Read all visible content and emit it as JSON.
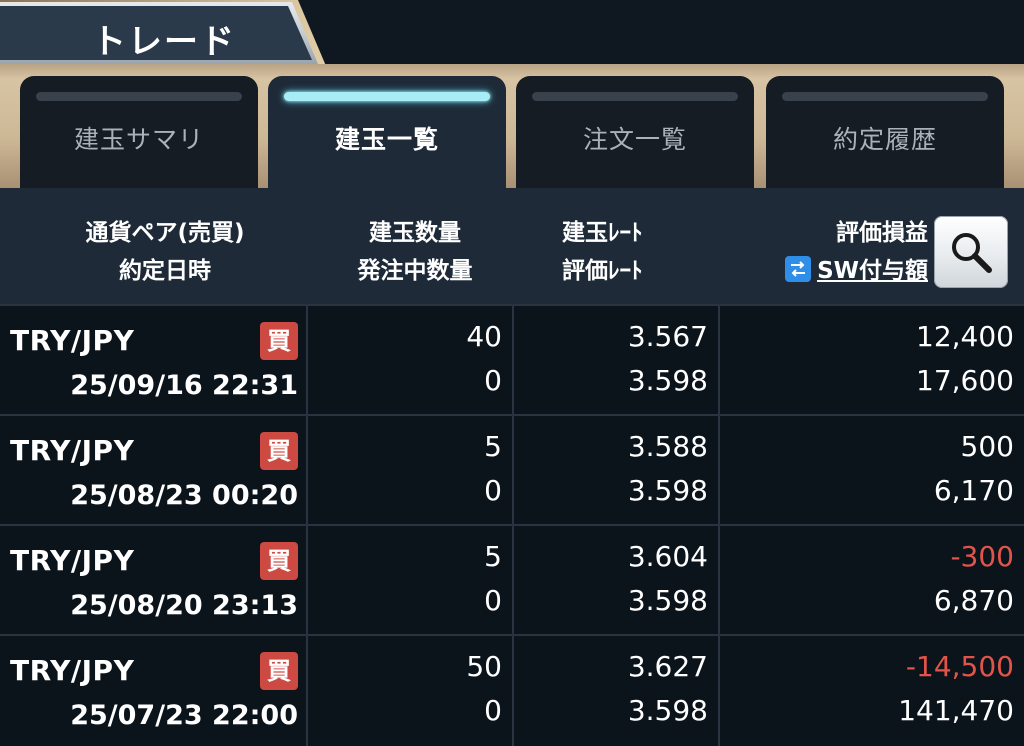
{
  "header": {
    "title": "トレード"
  },
  "tabs": [
    {
      "label": "建玉サマリ",
      "active": false
    },
    {
      "label": "建玉一覧",
      "active": true
    },
    {
      "label": "注文一覧",
      "active": false
    },
    {
      "label": "約定履歴",
      "active": false
    }
  ],
  "columns": {
    "col1_line1": "通貨ペア(売買)",
    "col1_line2": "約定日時",
    "col2_line1": "建玉数量",
    "col2_line2": "発注中数量",
    "col3_line1": "建玉ﾚｰﾄ",
    "col3_line2": "評価ﾚｰﾄ",
    "col4_line1": "評価損益",
    "col4_line2": "SW付与額",
    "swap_icon": "swap-arrows-icon",
    "search_icon": "magnifier-icon"
  },
  "colors": {
    "accent_tab": "#a8ecf6",
    "buy_badge": "#cc4a42",
    "negative": "#e2544a",
    "swap_icon_bg": "#2f8ee8"
  },
  "positions": [
    {
      "pair": "TRY/JPY",
      "side": "買",
      "datetime": "25/09/16 22:31",
      "quantity": "40",
      "pending": "0",
      "open_rate": "3.567",
      "eval_rate": "3.598",
      "pnl": "12,400",
      "pnl_negative": false,
      "swap": "17,600"
    },
    {
      "pair": "TRY/JPY",
      "side": "買",
      "datetime": "25/08/23 00:20",
      "quantity": "5",
      "pending": "0",
      "open_rate": "3.588",
      "eval_rate": "3.598",
      "pnl": "500",
      "pnl_negative": false,
      "swap": "6,170"
    },
    {
      "pair": "TRY/JPY",
      "side": "買",
      "datetime": "25/08/20 23:13",
      "quantity": "5",
      "pending": "0",
      "open_rate": "3.604",
      "eval_rate": "3.598",
      "pnl": "-300",
      "pnl_negative": true,
      "swap": "6,870"
    },
    {
      "pair": "TRY/JPY",
      "side": "買",
      "datetime": "25/07/23 22:00",
      "quantity": "50",
      "pending": "0",
      "open_rate": "3.627",
      "eval_rate": "3.598",
      "pnl": "-14,500",
      "pnl_negative": true,
      "swap": "141,470"
    }
  ]
}
